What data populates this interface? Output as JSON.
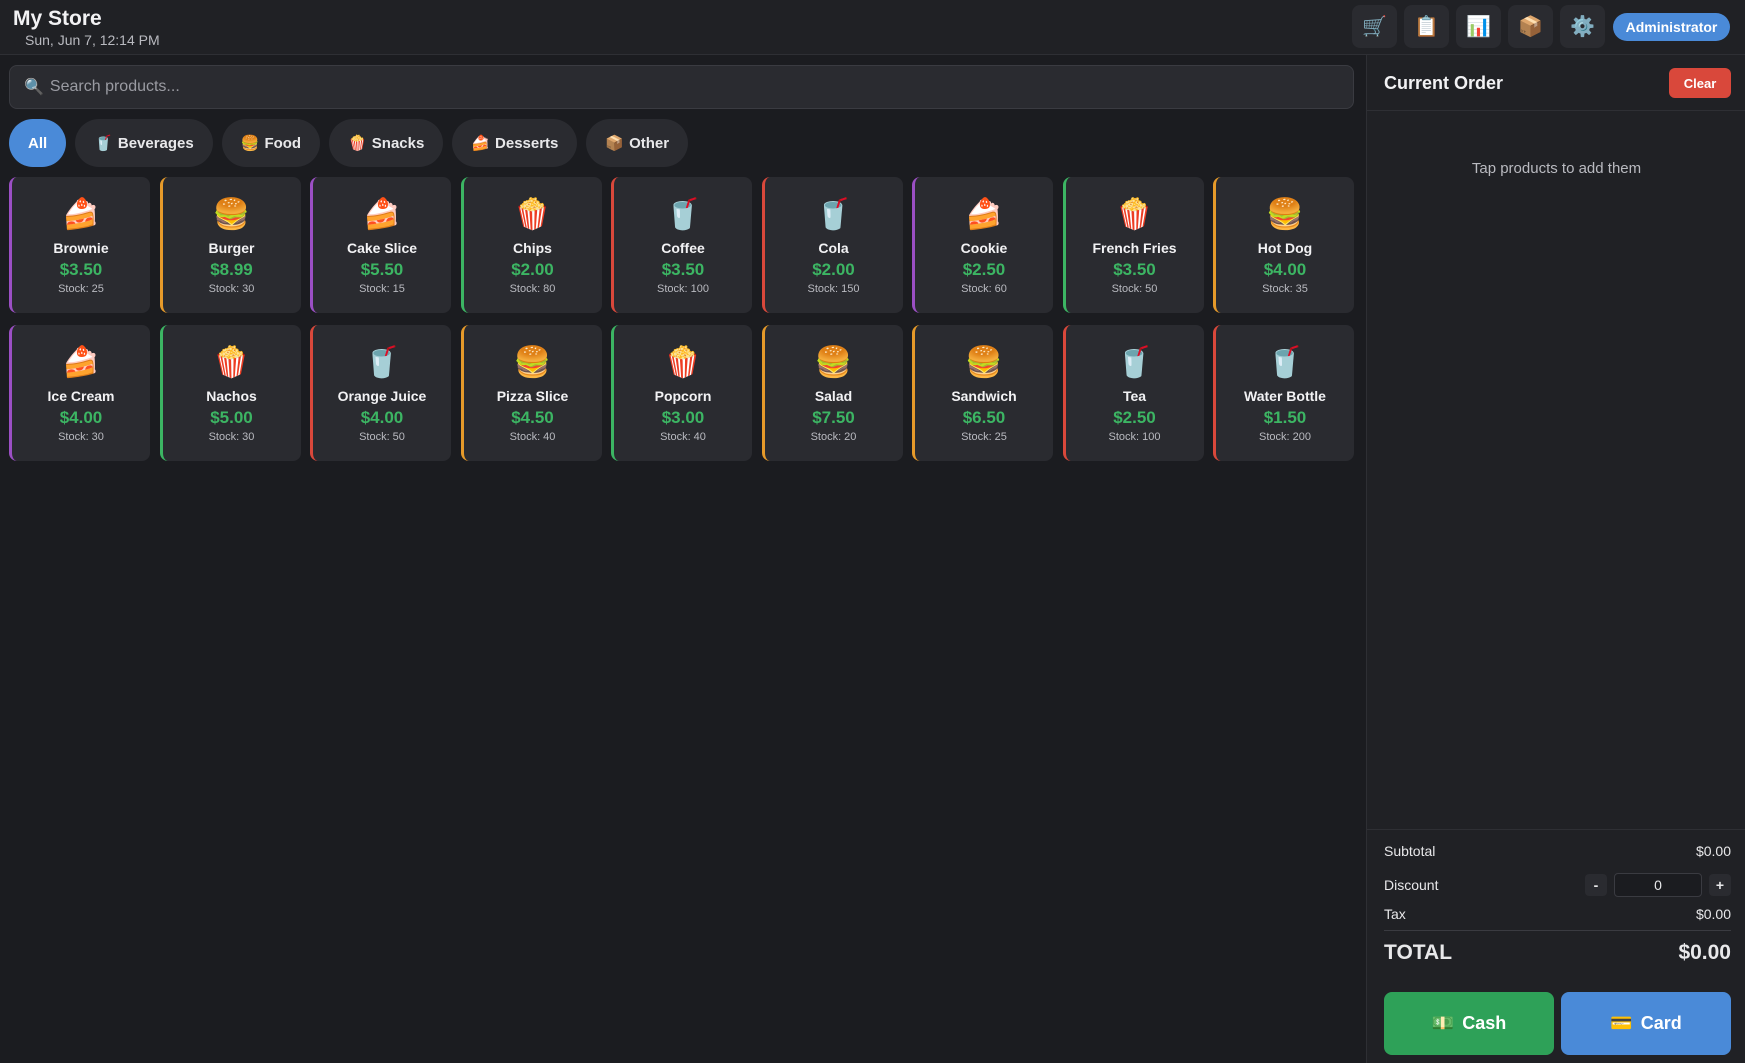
{
  "header": {
    "store_name": "My Store",
    "datetime": "Sun, Jun 7, 12:14 PM",
    "nav_icons": [
      "🛒",
      "📋",
      "📊",
      "📦",
      "⚙️"
    ],
    "user_role": "Administrator"
  },
  "search": {
    "icon": "🔍",
    "placeholder": "Search products..."
  },
  "categories": [
    {
      "label": "All",
      "icon": "",
      "active": true
    },
    {
      "label": "Beverages",
      "icon": "🥤",
      "active": false
    },
    {
      "label": "Food",
      "icon": "🍔",
      "active": false
    },
    {
      "label": "Snacks",
      "icon": "🍿",
      "active": false
    },
    {
      "label": "Desserts",
      "icon": "🍰",
      "active": false
    },
    {
      "label": "Other",
      "icon": "📦",
      "active": false
    }
  ],
  "category_colors": {
    "Beverages": "#d9483b",
    "Food": "#e69a2a",
    "Snacks": "#3cb563",
    "Desserts": "#9b4fc4"
  },
  "products": [
    {
      "name": "Brownie",
      "price": "$3.50",
      "stock": "Stock: 25",
      "icon": "🍰",
      "category": "Desserts"
    },
    {
      "name": "Burger",
      "price": "$8.99",
      "stock": "Stock: 30",
      "icon": "🍔",
      "category": "Food"
    },
    {
      "name": "Cake Slice",
      "price": "$5.50",
      "stock": "Stock: 15",
      "icon": "🍰",
      "category": "Desserts"
    },
    {
      "name": "Chips",
      "price": "$2.00",
      "stock": "Stock: 80",
      "icon": "🍿",
      "category": "Snacks"
    },
    {
      "name": "Coffee",
      "price": "$3.50",
      "stock": "Stock: 100",
      "icon": "🥤",
      "category": "Beverages"
    },
    {
      "name": "Cola",
      "price": "$2.00",
      "stock": "Stock: 150",
      "icon": "🥤",
      "category": "Beverages"
    },
    {
      "name": "Cookie",
      "price": "$2.50",
      "stock": "Stock: 60",
      "icon": "🍰",
      "category": "Desserts"
    },
    {
      "name": "French Fries",
      "price": "$3.50",
      "stock": "Stock: 50",
      "icon": "🍿",
      "category": "Snacks"
    },
    {
      "name": "Hot Dog",
      "price": "$4.00",
      "stock": "Stock: 35",
      "icon": "🍔",
      "category": "Food"
    },
    {
      "name": "Ice Cream",
      "price": "$4.00",
      "stock": "Stock: 30",
      "icon": "🍰",
      "category": "Desserts"
    },
    {
      "name": "Nachos",
      "price": "$5.00",
      "stock": "Stock: 30",
      "icon": "🍿",
      "category": "Snacks"
    },
    {
      "name": "Orange Juice",
      "price": "$4.00",
      "stock": "Stock: 50",
      "icon": "🥤",
      "category": "Beverages"
    },
    {
      "name": "Pizza Slice",
      "price": "$4.50",
      "stock": "Stock: 40",
      "icon": "🍔",
      "category": "Food"
    },
    {
      "name": "Popcorn",
      "price": "$3.00",
      "stock": "Stock: 40",
      "icon": "🍿",
      "category": "Snacks"
    },
    {
      "name": "Salad",
      "price": "$7.50",
      "stock": "Stock: 20",
      "icon": "🍔",
      "category": "Food"
    },
    {
      "name": "Sandwich",
      "price": "$6.50",
      "stock": "Stock: 25",
      "icon": "🍔",
      "category": "Food"
    },
    {
      "name": "Tea",
      "price": "$2.50",
      "stock": "Stock: 100",
      "icon": "🥤",
      "category": "Beverages"
    },
    {
      "name": "Water Bottle",
      "price": "$1.50",
      "stock": "Stock: 200",
      "icon": "🥤",
      "category": "Beverages"
    }
  ],
  "order": {
    "title": "Current Order",
    "clear_label": "Clear",
    "empty_message": "Tap products to add them",
    "subtotal_label": "Subtotal",
    "subtotal_value": "$0.00",
    "discount_label": "Discount",
    "discount_minus": "-",
    "discount_value": "0",
    "discount_plus": "+",
    "tax_label": "Tax",
    "tax_value": "$0.00",
    "total_label": "TOTAL",
    "total_value": "$0.00",
    "cash_icon": "💵",
    "cash_label": "Cash",
    "card_icon": "💳",
    "card_label": "Card"
  },
  "colors": {
    "accent_blue": "#4a8ad8",
    "price_green": "#3cb563",
    "danger_red": "#d9483b",
    "cash_green": "#2ea158"
  }
}
